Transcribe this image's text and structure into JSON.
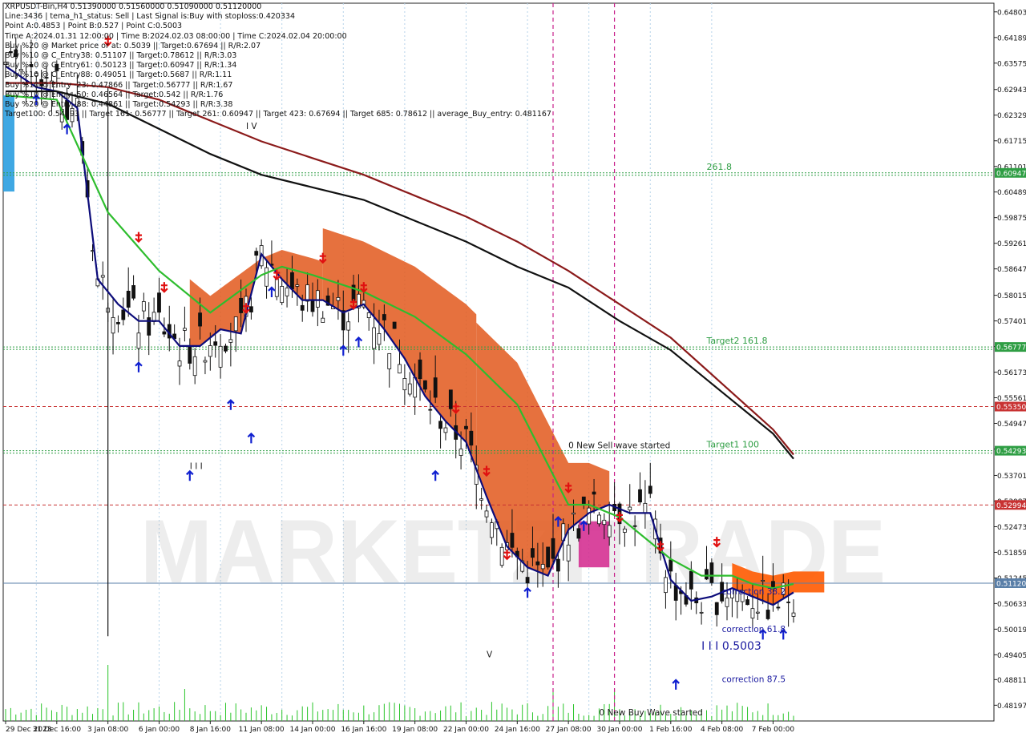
{
  "info_lines": [
    "XRPUSDT-Bin,H4  0.51390000 0.51560000 0.51090000 0.51120000",
    "Line:3436 | tema_h1_status: Sell | Last Signal is:Buy with stoploss:0.420334",
    "Point A:0.4853 | Point B:0.527 | Point C:0.5003",
    "Time A:2024.01.31 12:00:00 | Time B:2024.02.03 08:00:00 | Time C:2024.02.04 20:00:00",
    "Buy %20 @ Market price or at: 0.5039 || Target:0.67694 || R/R:2.07",
    "Buy %10 @ C_Entry38: 0.51107 || Target:0.78612 || R/R:3.03",
    "Buy %10 @ C_Entry61: 0.50123 || Target:0.60947 || R/R:1.34",
    "Buy %10 @ C_Entry88: 0.49051 || Target:0.5687 || R/R:1.11",
    "Buy %10 @ Entry -23: 0.47866 || Target:0.56777 || R/R:1.67",
    "Buy %10 @ Entry -50: 0.46564 || Target:0.542 || R/R:1.76",
    "Buy %20 @ Entry -88: 0.44861 || Target:0.54293 || R/R:3.38",
    "Target100: 0.54293 || Target 161: 0.56777 || Target 261: 0.60947 || Target 423: 0.67694 || Target 685: 0.78612 || average_Buy_entry: 0.481167"
  ],
  "watermark": "MARKETZITRADE",
  "chart_data": {
    "type": "line",
    "symbol": "XRPUSDT-Bin,H4",
    "ohlc": {
      "open": 0.5139,
      "high": 0.5156,
      "low": 0.5109,
      "close": 0.5112
    },
    "ylim": [
      0.4782,
      0.6501
    ],
    "y_ticks": [
      "0.64803",
      "0.64189",
      "0.63575",
      "0.62943",
      "0.62329",
      "0.61715",
      "0.61101",
      "0.60489",
      "0.59875",
      "0.59261",
      "0.58647",
      "0.58015",
      "0.57401",
      "0.56787",
      "0.56173",
      "0.55561",
      "0.54947",
      "0.54333",
      "0.53701",
      "0.53087",
      "0.52473",
      "0.51859",
      "0.51245",
      "0.50633",
      "0.50019",
      "0.49405",
      "0.48811",
      "0.48197"
    ],
    "x_ticks": [
      "29 Dec 2023",
      "31 Dec 16:00",
      "3 Jan 08:00",
      "6 Jan 00:00",
      "8 Jan 16:00",
      "11 Jan 08:00",
      "14 Jan 00:00",
      "16 Jan 16:00",
      "19 Jan 08:00",
      "22 Jan 00:00",
      "24 Jan 16:00",
      "27 Jan 08:00",
      "30 Jan 00:00",
      "1 Feb 16:00",
      "4 Feb 08:00",
      "7 Feb 00:00"
    ],
    "horizontal_levels": [
      {
        "label": "0.60947",
        "value": 0.60947,
        "color": "#2f9e44",
        "style": "dotted",
        "annotation": "261.8"
      },
      {
        "label": "0.56777",
        "value": 0.56777,
        "color": "#2f9e44",
        "style": "dotted",
        "annotation": "Target2  161.8"
      },
      {
        "label": "0.55350",
        "value": 0.5535,
        "color": "#c83232",
        "style": "dashed",
        "annotation": ""
      },
      {
        "label": "0.54293",
        "value": 0.54293,
        "color": "#2f9e44",
        "style": "dotted",
        "annotation": "Target1  100"
      },
      {
        "label": "0.52994",
        "value": 0.52994,
        "color": "#c83232",
        "style": "dashed",
        "annotation": ""
      },
      {
        "label": "0.51120",
        "value": 0.5112,
        "color": "#5a7fa8",
        "style": "solid",
        "annotation": ""
      }
    ],
    "series": [
      {
        "name": "",
        "color": "#0c0c7a",
        "x": [
          0,
          6,
          10,
          14,
          18,
          22,
          26,
          30,
          34,
          38,
          42,
          46,
          50,
          54,
          58,
          62,
          66,
          70,
          74,
          78,
          82,
          86,
          90,
          94,
          98,
          102,
          106,
          110,
          114,
          118,
          122,
          126,
          130,
          134,
          138,
          142,
          146,
          150,
          154
        ],
        "values": [
          0.635,
          0.63,
          0.629,
          0.625,
          0.584,
          0.578,
          0.574,
          0.574,
          0.568,
          0.568,
          0.572,
          0.571,
          0.59,
          0.584,
          0.579,
          0.579,
          0.576,
          0.578,
          0.572,
          0.565,
          0.556,
          0.55,
          0.545,
          0.532,
          0.52,
          0.515,
          0.513,
          0.524,
          0.528,
          0.53,
          0.528,
          0.528,
          0.512,
          0.507,
          0.508,
          0.51,
          0.508,
          0.506,
          0.509
        ]
      },
      {
        "name": "",
        "color": "#2ebd2e",
        "x": [
          0,
          10,
          20,
          30,
          40,
          50,
          54,
          60,
          70,
          80,
          90,
          100,
          110,
          114,
          120,
          130,
          136,
          142,
          146,
          150,
          154
        ],
        "values": [
          0.628,
          0.627,
          0.6,
          0.586,
          0.576,
          0.585,
          0.587,
          0.585,
          0.581,
          0.575,
          0.566,
          0.554,
          0.53,
          0.53,
          0.527,
          0.517,
          0.513,
          0.513,
          0.511,
          0.51,
          0.511
        ]
      },
      {
        "name": "",
        "color": "#111111",
        "x": [
          0,
          10,
          20,
          30,
          40,
          50,
          60,
          70,
          80,
          90,
          100,
          110,
          120,
          130,
          140,
          150,
          154
        ],
        "values": [
          0.629,
          0.629,
          0.626,
          0.62,
          0.614,
          0.609,
          0.606,
          0.603,
          0.598,
          0.593,
          0.587,
          0.582,
          0.574,
          0.567,
          0.557,
          0.547,
          0.541
        ]
      },
      {
        "name": "",
        "color": "#8b1a1a",
        "x": [
          0,
          10,
          20,
          30,
          40,
          50,
          60,
          70,
          80,
          90,
          100,
          110,
          120,
          130,
          140,
          150,
          154
        ],
        "values": [
          0.631,
          0.631,
          0.63,
          0.627,
          0.622,
          0.617,
          0.613,
          0.609,
          0.604,
          0.599,
          0.593,
          0.586,
          0.578,
          0.57,
          0.559,
          0.548,
          0.542
        ]
      }
    ],
    "annotations": [
      {
        "text": "0 New Sell wave started",
        "x": 110,
        "y": 0.5435
      },
      {
        "text": "0 New Buy Wave started",
        "x": 116,
        "y": 0.4795
      },
      {
        "text": "correction 38.2",
        "x": 140,
        "y": 0.5085
      },
      {
        "text": "correction 61.8",
        "x": 140,
        "y": 0.4995
      },
      {
        "text": "correction 87.5",
        "x": 140,
        "y": 0.4875
      },
      {
        "text": "I I I 0.5003",
        "x": 136,
        "y": 0.4953
      },
      {
        "text": "I V",
        "x": 47,
        "y": 0.62
      },
      {
        "text": "I I I",
        "x": 36,
        "y": 0.5385
      },
      {
        "text": "V",
        "x": 94,
        "y": 0.4935
      }
    ],
    "vertical_markers": [
      {
        "x": 107,
        "color": "#c8208a"
      },
      {
        "x": 119,
        "color": "#c8208a"
      }
    ],
    "grid": true
  }
}
